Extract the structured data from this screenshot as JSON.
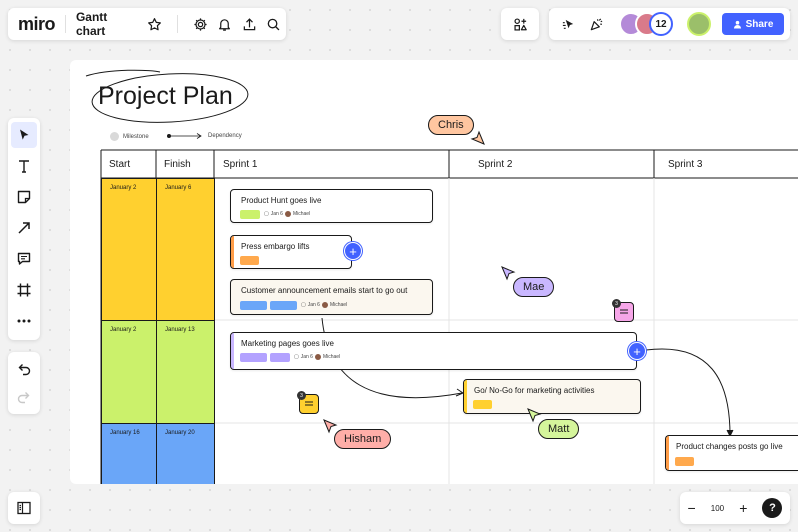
{
  "app": {
    "logo": "miro",
    "board_name": "Gantt chart"
  },
  "topbar": {
    "participants_count": "12",
    "share_label": "Share"
  },
  "zoom": {
    "minus": "−",
    "value": "100",
    "plus": "+",
    "help": "?"
  },
  "frame": {
    "title": "Project Plan",
    "legend": {
      "milestone": "Milestone",
      "dependency": "Dependency"
    },
    "columns": {
      "start": "Start",
      "finish": "Finish",
      "sprint1": "Sprint 1",
      "sprint2": "Sprint 2",
      "sprint3": "Sprint 3"
    },
    "rows": [
      {
        "start": "January 2",
        "finish": "January 6"
      },
      {
        "start": "January 2",
        "finish": "January 13"
      },
      {
        "start": "January 16",
        "finish": "January 20"
      }
    ],
    "tasks": {
      "product_hunt": {
        "title": "Product Hunt goes live",
        "date": "Jan 6",
        "owner": "Michael"
      },
      "press": {
        "title": "Press embargo lifts"
      },
      "customer": {
        "title": "Customer announcement emails start to go out",
        "date": "Jan 6",
        "owner": "Michael"
      },
      "marketing": {
        "title": "Marketing pages goes live",
        "date": "Jan 6",
        "owner": "Michael"
      },
      "gonogo": {
        "title": "Go/ No-Go for marketing activities"
      },
      "product_changes": {
        "title": "Product changes posts go live"
      }
    },
    "cursors": {
      "chris": "Chris",
      "mae": "Mae",
      "hisham": "Hisham",
      "matt": "Matt"
    },
    "comments": {
      "comment1_count": "3",
      "comment2_count": "3"
    }
  },
  "colors": {
    "accent": "#4262ff",
    "yellow_row": "#ffd02f",
    "green_row": "#cbf16b",
    "blue_row": "#6aa6f8",
    "chris": "#ffc6a0",
    "mae": "#c9b7ff",
    "hisham": "#ffaea8",
    "matt": "#d5f59b"
  }
}
